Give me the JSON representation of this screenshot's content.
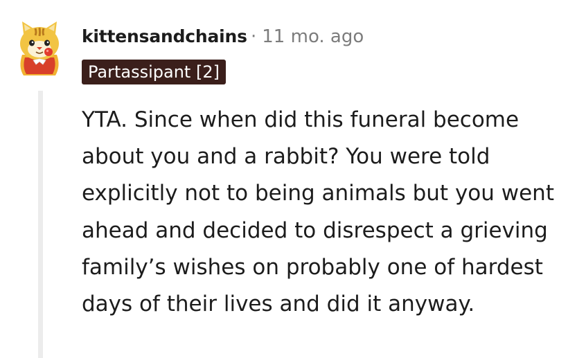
{
  "comment": {
    "username": "kittensandchains",
    "separator": "·",
    "timestamp": "11 mo. ago",
    "flair": "Partassipant [2]",
    "body": "YTA. Since when did this funeral become about you and a rabbit? You were told explicitly not to being animals but you went ahead and decided to disrespect a grieving family’s wishes on probably one of hardest days of their lives and did it anyway.",
    "avatar_icon": "cat-avatar-icon"
  },
  "colors": {
    "flair_background": "#3b1f1b",
    "meta_text": "#7c7c7c",
    "thread_line": "#ececec"
  }
}
